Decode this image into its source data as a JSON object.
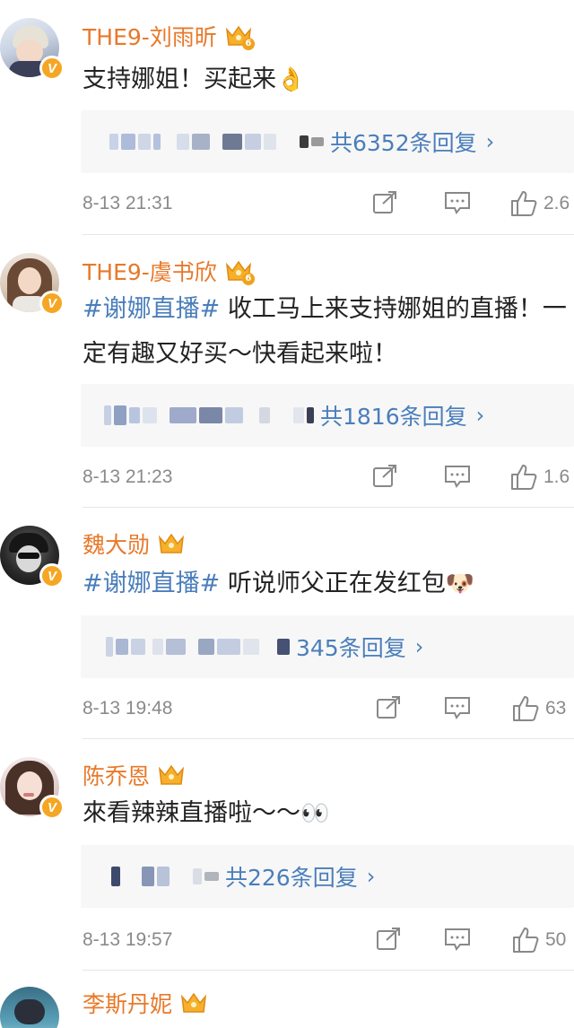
{
  "comments": [
    {
      "name": "THE9-刘雨昕",
      "crown_level": "6",
      "text_segments": [
        {
          "t": "支持娜姐！买起来",
          "tag": false
        }
      ],
      "emoji": "👌",
      "reply_count": "共6352条回复",
      "time": "8-13 21:31",
      "likes": "2.6"
    },
    {
      "name": "THE9-虞书欣",
      "crown_level": "6",
      "text_segments": [
        {
          "t": "#谢娜直播#",
          "tag": true
        },
        {
          "t": " 收工马上来支持娜姐的直播！一定有趣又好买～快看起来啦！",
          "tag": false
        }
      ],
      "emoji": "",
      "reply_count": "共1816条回复",
      "time": "8-13 21:23",
      "likes": "1.6"
    },
    {
      "name": "魏大勋",
      "crown_level": "",
      "text_segments": [
        {
          "t": "#谢娜直播#",
          "tag": true
        },
        {
          "t": " 听说师父正在发红包",
          "tag": false
        }
      ],
      "emoji": "🐶",
      "reply_count": "345条回复",
      "time": "8-13 19:48",
      "likes": "63"
    },
    {
      "name": "陈乔恩",
      "crown_level": "",
      "text_segments": [
        {
          "t": "來看辣辣直播啦～～",
          "tag": false
        }
      ],
      "emoji": "👀",
      "reply_count": "共226条回复",
      "time": "8-13 19:57",
      "likes": "50"
    },
    {
      "name": "李斯丹妮",
      "crown_level": "",
      "text_segments": [],
      "emoji": "",
      "reply_count": "",
      "time": "",
      "likes": ""
    }
  ],
  "icons": {
    "verified": "V",
    "reply_chevron": "›"
  },
  "colors": {
    "username": "#e8792a",
    "link": "#4a7ebb",
    "meta": "#8a8a8a",
    "badge": "#f5a623",
    "reply_bg": "#f7f7f7"
  }
}
